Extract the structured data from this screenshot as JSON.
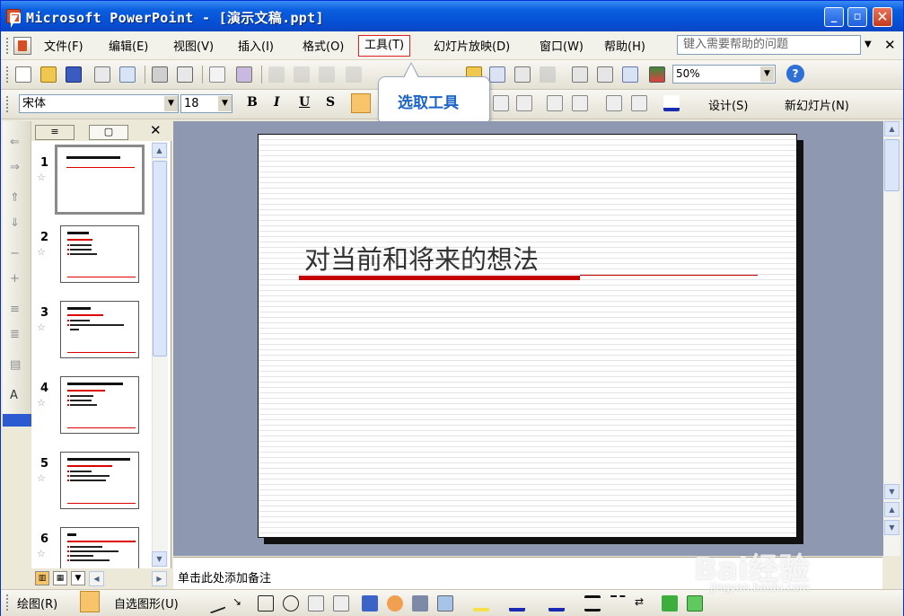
{
  "window": {
    "title": "Microsoft PowerPoint - [演示文稿.ppt]"
  },
  "menu": [
    {
      "label": "文件(F)"
    },
    {
      "label": "编辑(E)"
    },
    {
      "label": "视图(V)"
    },
    {
      "label": "插入(I)"
    },
    {
      "label": "格式(O)"
    },
    {
      "label": "工具(T)"
    },
    {
      "label": "幻灯片放映(D)"
    },
    {
      "label": "窗口(W)"
    },
    {
      "label": "帮助(H)"
    }
  ],
  "help_search": {
    "placeholder": "键入需要帮助的问题"
  },
  "toolbar": {
    "zoom": "50%"
  },
  "formatting": {
    "font_name": "宋体",
    "font_size": "18",
    "bold": "B",
    "italic": "I",
    "underline": "U",
    "shadow": "S",
    "design_label": "设计(S)",
    "new_slide_label": "新幻灯片(N)"
  },
  "callout": {
    "text": "选取工具"
  },
  "slides": [
    {
      "num": "1"
    },
    {
      "num": "2"
    },
    {
      "num": "3"
    },
    {
      "num": "4"
    },
    {
      "num": "5"
    },
    {
      "num": "6"
    }
  ],
  "slide": {
    "title": "对当前和将来的想法"
  },
  "notes": {
    "placeholder": "单击此处添加备注"
  },
  "drawing": {
    "draw_label": "绘图(R)",
    "autoshape_label": "自选图形(U)"
  },
  "watermark": {
    "brand": "Bai经验",
    "url": "jingyan.baidu.com"
  },
  "colors": {
    "titlebar": "#0a5fde",
    "accent_red": "#c40000",
    "canvas_bg": "#8e98b0"
  }
}
